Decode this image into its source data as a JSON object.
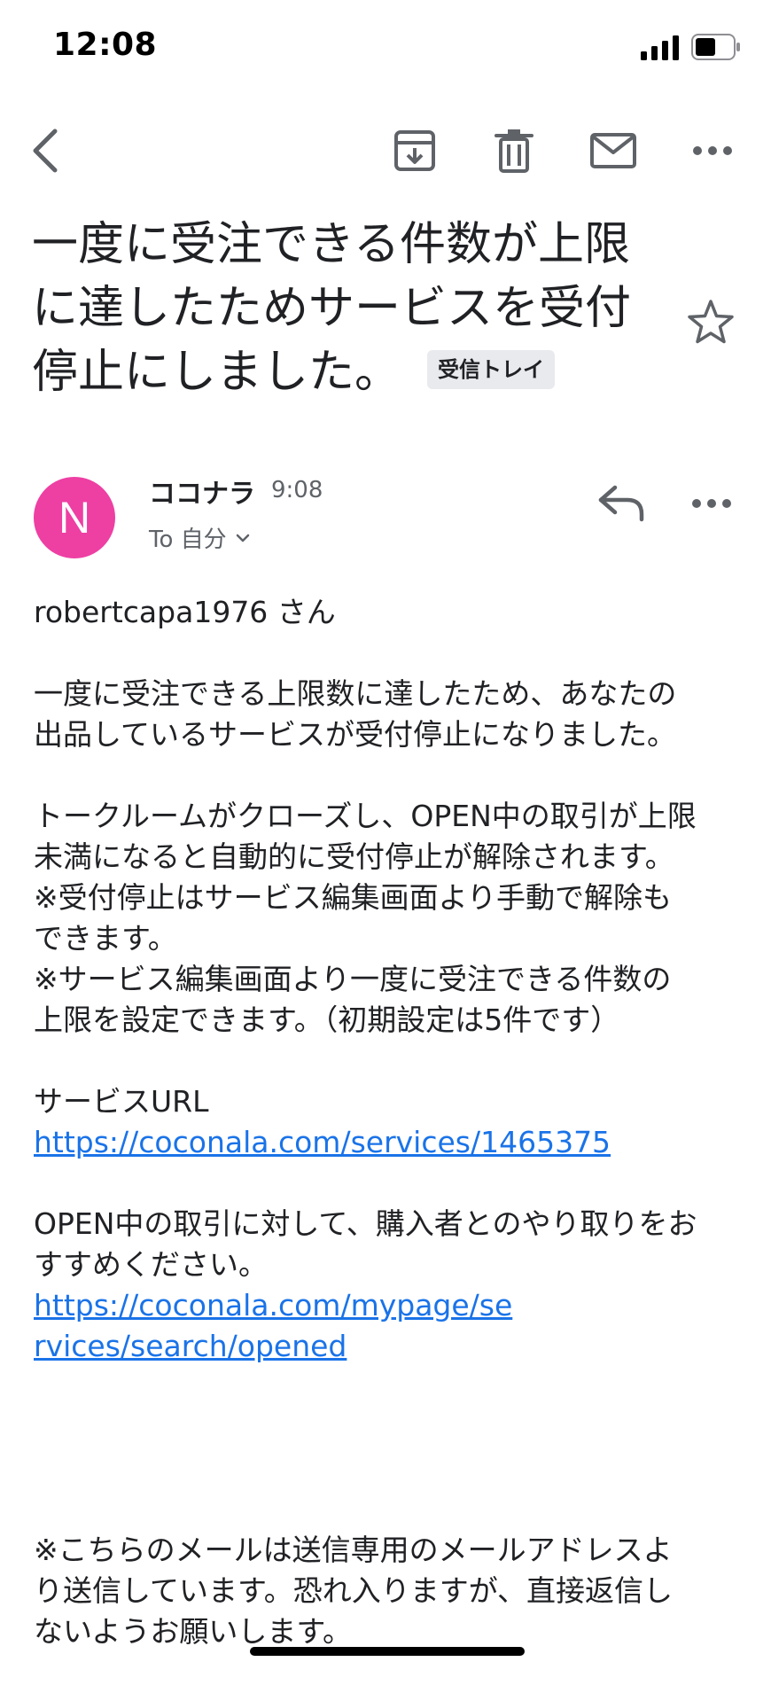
{
  "status_bar": {
    "time": "12:08"
  },
  "icons": {
    "back": "chevron-left-icon",
    "archive": "archive-icon",
    "delete": "trash-icon",
    "mark_unread": "mail-icon",
    "more": "more-horizontal-icon",
    "star": "star-outline-icon",
    "reply": "reply-icon",
    "recipient_toggle": "chevron-down-icon"
  },
  "subject": {
    "lines": [
      "一度に受注できる件数が上限",
      "に達したためサービスを受付",
      "停止にしました。"
    ],
    "label": "受信トレイ"
  },
  "sender": {
    "avatar_letter": "N",
    "avatar_color": "#ee3fa3",
    "name": "ココナラ",
    "time": "9:08",
    "recipient": "To 自分"
  },
  "body": {
    "greeting": "robertcapa1976 さん",
    "para1": [
      "一度に受注できる上限数に達したため、あなたの",
      "出品しているサービスが受付停止になりました。"
    ],
    "para2": [
      "トークルームがクローズし、OPEN中の取引が上限",
      "未満になると自動的に受付停止が解除されます。",
      "※受付停止はサービス編集画面より手動で解除も",
      "できます。",
      "※サービス編集画面より一度に受注できる件数の",
      "上限を設定できます。（初期設定は5件です）"
    ],
    "service_url_label": "サービスURL",
    "service_url": "https://coconala.com/services/1465375",
    "para3": [
      "OPEN中の取引に対して、購入者とのやり取りをお",
      "すすめください。"
    ],
    "opened_url_lines": [
      "https://coconala.com/mypage/se",
      "rvices/search/opened"
    ],
    "footer": [
      "※こちらのメールは送信専用のメールアドレスよ",
      "り送信しています。恐れ入りますが、直接返信し",
      "ないようお願いします。"
    ]
  },
  "colors": {
    "link": "#1a73e8",
    "icon_gray": "#5f6368",
    "label_bg": "#e8eaed"
  }
}
